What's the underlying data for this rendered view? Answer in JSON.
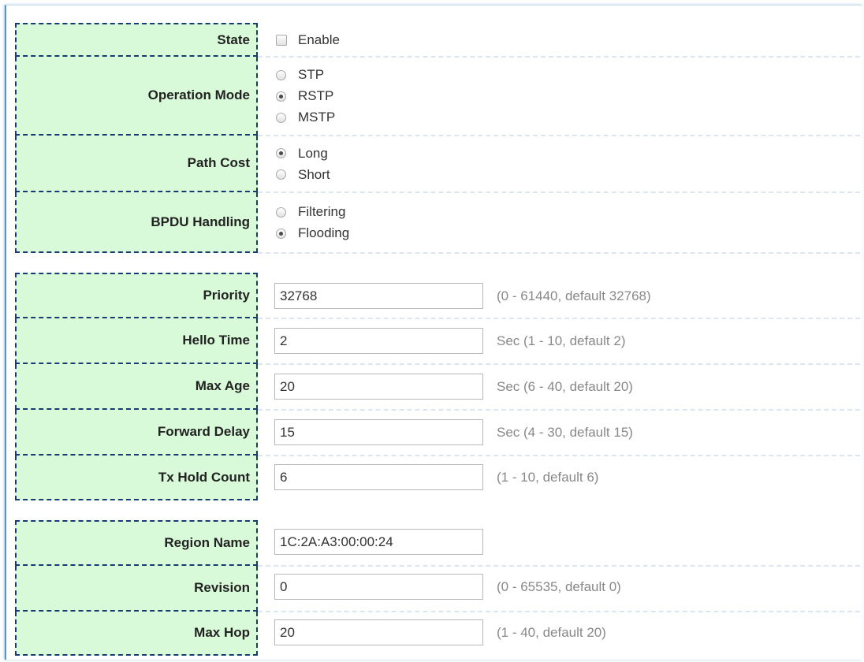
{
  "state": {
    "label": "State",
    "option": "Enable",
    "checked": false
  },
  "operation_mode": {
    "label": "Operation Mode",
    "options": [
      "STP",
      "RSTP",
      "MSTP"
    ],
    "selected": "RSTP"
  },
  "path_cost": {
    "label": "Path Cost",
    "options": [
      "Long",
      "Short"
    ],
    "selected": "Long"
  },
  "bpdu_handling": {
    "label": "BPDU Handling",
    "options": [
      "Filtering",
      "Flooding"
    ],
    "selected": "Flooding"
  },
  "priority": {
    "label": "Priority",
    "value": "32768",
    "hint": "(0 - 61440, default 32768)"
  },
  "hello_time": {
    "label": "Hello Time",
    "value": "2",
    "hint": "Sec (1 - 10, default 2)"
  },
  "max_age": {
    "label": "Max Age",
    "value": "20",
    "hint": "Sec (6 - 40, default 20)"
  },
  "forward_delay": {
    "label": "Forward Delay",
    "value": "15",
    "hint": "Sec (4 - 30, default 15)"
  },
  "tx_hold_count": {
    "label": "Tx Hold Count",
    "value": "6",
    "hint": "(1 - 10, default 6)"
  },
  "region_name": {
    "label": "Region Name",
    "value": "1C:2A:A3:00:00:24"
  },
  "revision": {
    "label": "Revision",
    "value": "0",
    "hint": "(0 - 65535, default 0)"
  },
  "max_hop": {
    "label": "Max Hop",
    "value": "20",
    "hint": "(1 - 40, default 20)"
  }
}
